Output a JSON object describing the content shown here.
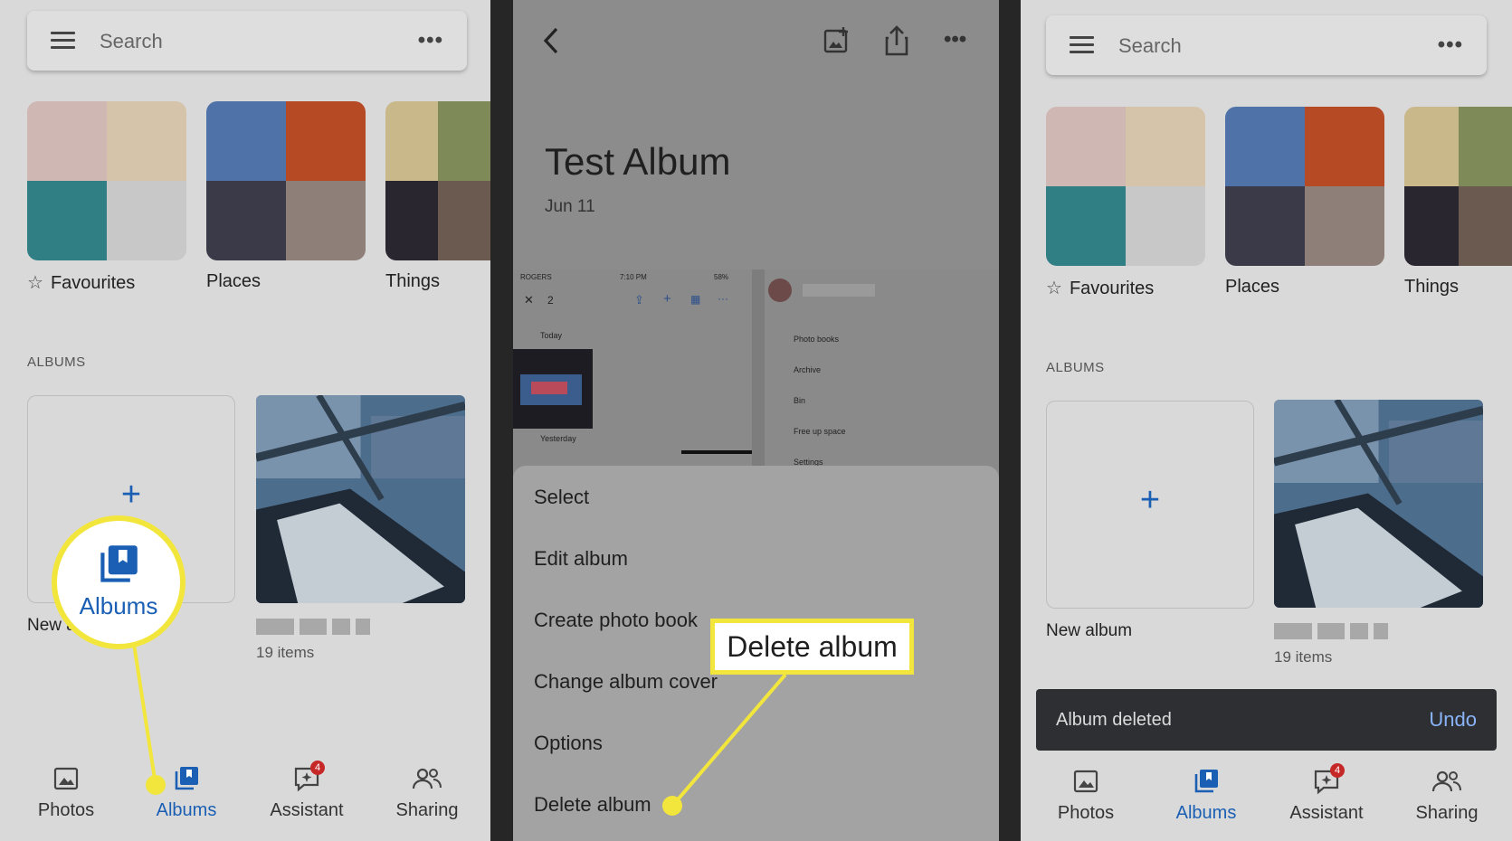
{
  "panel1": {
    "search_placeholder": "Search",
    "categories": [
      "Favourites",
      "Places",
      "Things"
    ],
    "section_title": "ALBUMS",
    "new_album_label_partial": "New a",
    "album_item_count": "19 items",
    "callout_label": "Albums",
    "nav": [
      "Photos",
      "Albums",
      "Assistant",
      "Sharing"
    ],
    "assistant_badge": "4"
  },
  "panel2": {
    "album_title": "Test Album",
    "album_date": "Jun 11",
    "embedded": {
      "carrier": "ROGERS",
      "time": "7:10 PM",
      "battery": "58%",
      "selected_count": "2",
      "today": "Today",
      "yesterday": "Yesterday",
      "menu": [
        "Photo books",
        "Archive",
        "Bin",
        "Free up space",
        "Settings"
      ]
    },
    "menu_items": [
      "Select",
      "Edit album",
      "Create photo book",
      "Change album cover",
      "Options",
      "Delete album"
    ],
    "callout_label": "Delete album"
  },
  "panel3": {
    "search_placeholder": "Search",
    "categories": [
      "Favourites",
      "Places",
      "Things"
    ],
    "section_title": "ALBUMS",
    "new_album_label": "New album",
    "album_item_count": "19 items",
    "snackbar_message": "Album deleted",
    "snackbar_action": "Undo",
    "nav": [
      "Photos",
      "Albums",
      "Assistant",
      "Sharing"
    ],
    "assistant_badge": "4"
  },
  "colors": {
    "accent_blue": "#1a5fb4",
    "highlight_yellow": "#f2e63d",
    "snackbar_bg": "#2d2f33",
    "undo_link": "#8ab4f8"
  }
}
